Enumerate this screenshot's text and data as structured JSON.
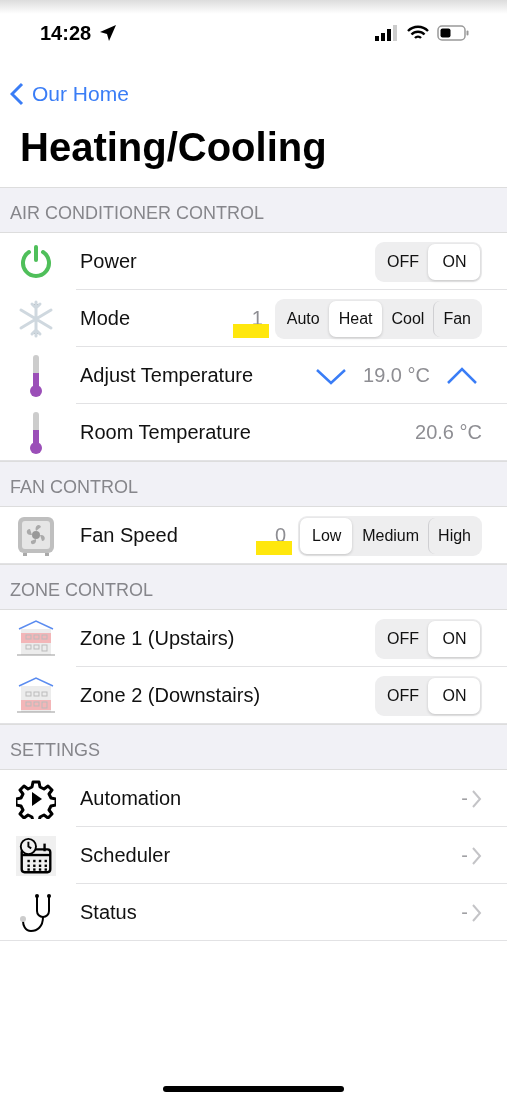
{
  "status_bar": {
    "time": "14:28"
  },
  "nav": {
    "back": "Our Home",
    "title": "Heating/Cooling"
  },
  "sections": [
    {
      "header": "AIR CONDITIONER CONTROL",
      "rows": [
        {
          "kind": "toggle",
          "label": "Power",
          "segments": [
            {
              "label": "OFF",
              "selected": false
            },
            {
              "label": "ON",
              "selected": true
            }
          ]
        },
        {
          "kind": "segmented",
          "label": "Mode",
          "value": "1",
          "highlighted": true,
          "segments": [
            {
              "label": "Auto",
              "selected": false
            },
            {
              "label": "Heat",
              "selected": true
            },
            {
              "label": "Cool",
              "selected": false
            },
            {
              "label": "Fan",
              "selected": false
            }
          ]
        },
        {
          "kind": "stepper",
          "label": "Adjust Temperature",
          "value": "19.0 °C"
        },
        {
          "kind": "value",
          "label": "Room Temperature",
          "value": "20.6 °C"
        }
      ]
    },
    {
      "header": "FAN CONTROL",
      "rows": [
        {
          "kind": "segmented",
          "label": "Fan Speed",
          "value": "0",
          "highlighted": true,
          "segments": [
            {
              "label": "Low",
              "selected": true
            },
            {
              "label": "Medium",
              "selected": false
            },
            {
              "label": "High",
              "selected": false
            }
          ]
        }
      ]
    },
    {
      "header": "ZONE CONTROL",
      "rows": [
        {
          "kind": "toggle",
          "label": "Zone 1 (Upstairs)",
          "segments": [
            {
              "label": "OFF",
              "selected": false
            },
            {
              "label": "ON",
              "selected": true
            }
          ]
        },
        {
          "kind": "toggle",
          "label": "Zone 2 (Downstairs)",
          "segments": [
            {
              "label": "OFF",
              "selected": false
            },
            {
              "label": "ON",
              "selected": true
            }
          ]
        }
      ]
    },
    {
      "header": "SETTINGS",
      "rows": [
        {
          "kind": "link",
          "label": "Automation",
          "value": "-"
        },
        {
          "kind": "link",
          "label": "Scheduler",
          "value": "-"
        },
        {
          "kind": "link",
          "label": "Status",
          "value": "-"
        }
      ]
    }
  ]
}
